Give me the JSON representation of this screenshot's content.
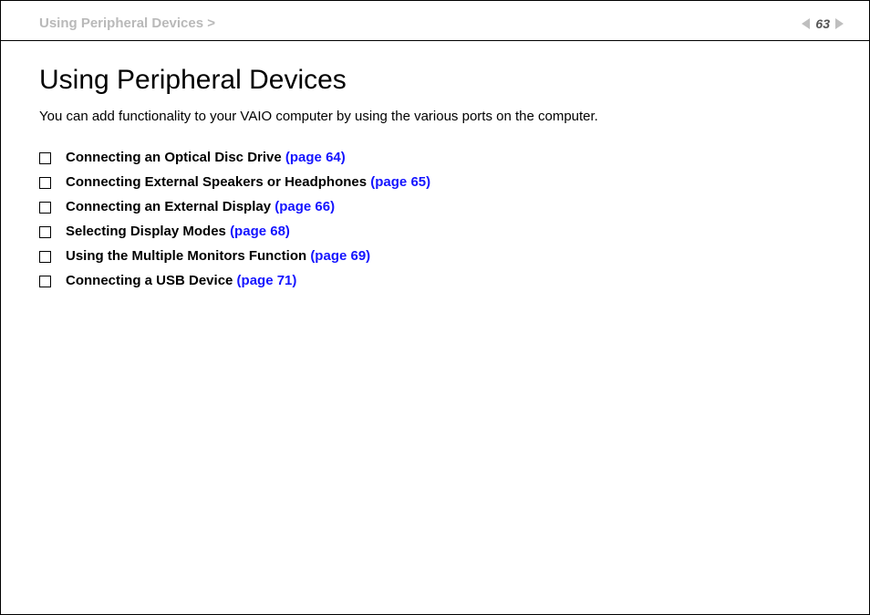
{
  "header": {
    "breadcrumb": "Using Peripheral Devices >",
    "page_number": "63"
  },
  "main": {
    "title": "Using Peripheral Devices",
    "intro": "You can add functionality to your VAIO computer by using the various ports on the computer.",
    "topics": [
      {
        "label": "Connecting an Optical Disc Drive ",
        "ref": "(page 64)"
      },
      {
        "label": "Connecting External Speakers or Headphones ",
        "ref": "(page 65)"
      },
      {
        "label": "Connecting an External Display ",
        "ref": "(page 66)"
      },
      {
        "label": "Selecting Display Modes ",
        "ref": "(page 68)"
      },
      {
        "label": "Using the Multiple Monitors Function ",
        "ref": "(page 69)"
      },
      {
        "label": "Connecting a USB Device ",
        "ref": "(page 71)"
      }
    ]
  }
}
